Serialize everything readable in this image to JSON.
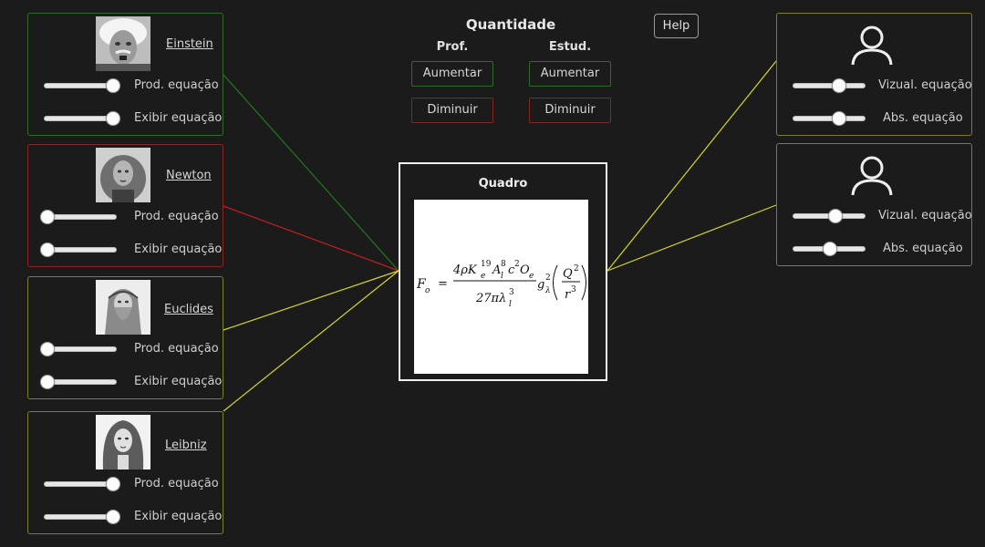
{
  "quantity": {
    "title": "Quantidade",
    "prof_label": "Prof.",
    "student_label": "Estud.",
    "increase_label": "Aumentar",
    "decrease_label": "Diminuir"
  },
  "help_label": "Help",
  "board": {
    "title": "Quadro",
    "formula": {
      "lhs": "F",
      "lhs_sub": "o",
      "equals": "=",
      "numerator": "4ρK",
      "num_rest": "A",
      "num_tail": "c",
      "num_O": "O",
      "denominator": "27πλ",
      "g": "g",
      "Q": "Q",
      "r": "r"
    }
  },
  "professors": [
    {
      "name": "Einstein",
      "border": "green",
      "prod_label": "Prod. equação",
      "prod_value": 1.0,
      "show_label": "Exibir equação",
      "show_value": 1.0
    },
    {
      "name": "Newton",
      "border": "red",
      "prod_label": "Prod. equação",
      "prod_value": 0.0,
      "show_label": "Exibir equação",
      "show_value": 0.0
    },
    {
      "name": "Euclides",
      "border": "yellow",
      "prod_label": "Prod. equação",
      "prod_value": 0.0,
      "show_label": "Exibir equação",
      "show_value": 0.0
    },
    {
      "name": "Leibniz",
      "border": "yellow",
      "prod_label": "Prod. equação",
      "prod_value": 1.0,
      "show_label": "Exibir equação",
      "show_value": 1.0
    }
  ],
  "students": [
    {
      "view_label": "Vizual. equação",
      "view_value": 0.65,
      "abs_label": "Abs. equação",
      "abs_value": 0.65
    },
    {
      "view_label": "Vizual. equação",
      "view_value": 0.6,
      "abs_label": "Abs. equação",
      "abs_value": 0.52
    }
  ],
  "colors": {
    "green": "#2f6a2c",
    "red": "#8a2424",
    "yellow": "#7f7f1f",
    "link_green": "#1f7a1f",
    "link_red": "#c41f1f",
    "link_yellow": "#d8d820",
    "background": "#1b1b1b"
  },
  "icons": [
    "user-icon",
    "portrait-einstein",
    "portrait-newton",
    "portrait-euclides",
    "portrait-leibniz"
  ]
}
